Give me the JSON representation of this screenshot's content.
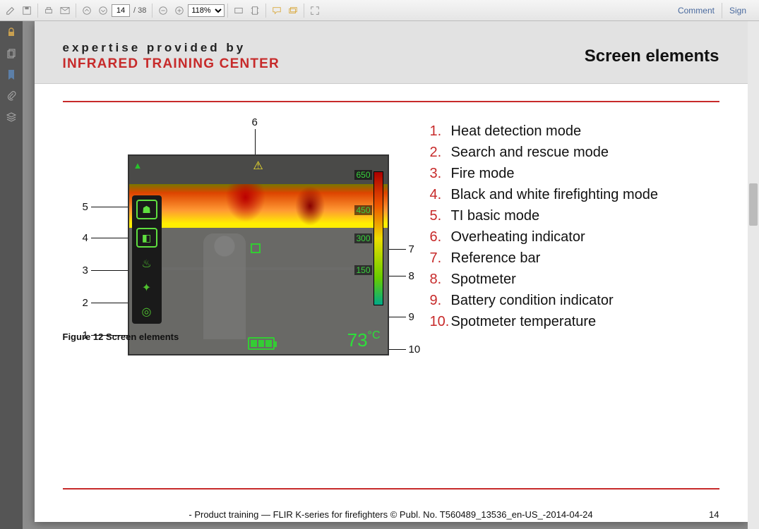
{
  "toolbar": {
    "page_current": "14",
    "page_total": "/ 38",
    "zoom": "118%",
    "comment": "Comment",
    "sign": "Sign"
  },
  "header": {
    "brand_top": "expertise provided by",
    "brand_bottom": "INFRARED TRAINING CENTER",
    "section_title": "Screen elements"
  },
  "screen": {
    "ref_labels": [
      "650",
      "450",
      "300",
      "150"
    ],
    "temp_value": "73",
    "temp_unit": "°C"
  },
  "callouts": {
    "left": [
      "5",
      "4",
      "3",
      "2",
      "1"
    ],
    "top": "6",
    "right": [
      "7",
      "8",
      "9",
      "10"
    ]
  },
  "figure_caption": "Figure 12 Screen elements",
  "legend": [
    {
      "num": "1.",
      "txt": "Heat detection mode"
    },
    {
      "num": "2.",
      "txt": "Search and rescue mode"
    },
    {
      "num": "3.",
      "txt": "Fire mode"
    },
    {
      "num": "4.",
      "txt": "Black and white firefighting mode"
    },
    {
      "num": "5.",
      "txt": "TI basic mode"
    },
    {
      "num": "6.",
      "txt": "Overheating indicator"
    },
    {
      "num": "7.",
      "txt": "Reference bar"
    },
    {
      "num": "8.",
      "txt": "Spotmeter"
    },
    {
      "num": "9.",
      "txt": "Battery condition indicator"
    },
    {
      "num": "10.",
      "txt": "Spotmeter temperature"
    }
  ],
  "footer": {
    "center": "- Product training — FLIR K-series for firefighters © Publ. No. T560489_13536_en-US_-2014-04-24",
    "page_num": "14"
  }
}
